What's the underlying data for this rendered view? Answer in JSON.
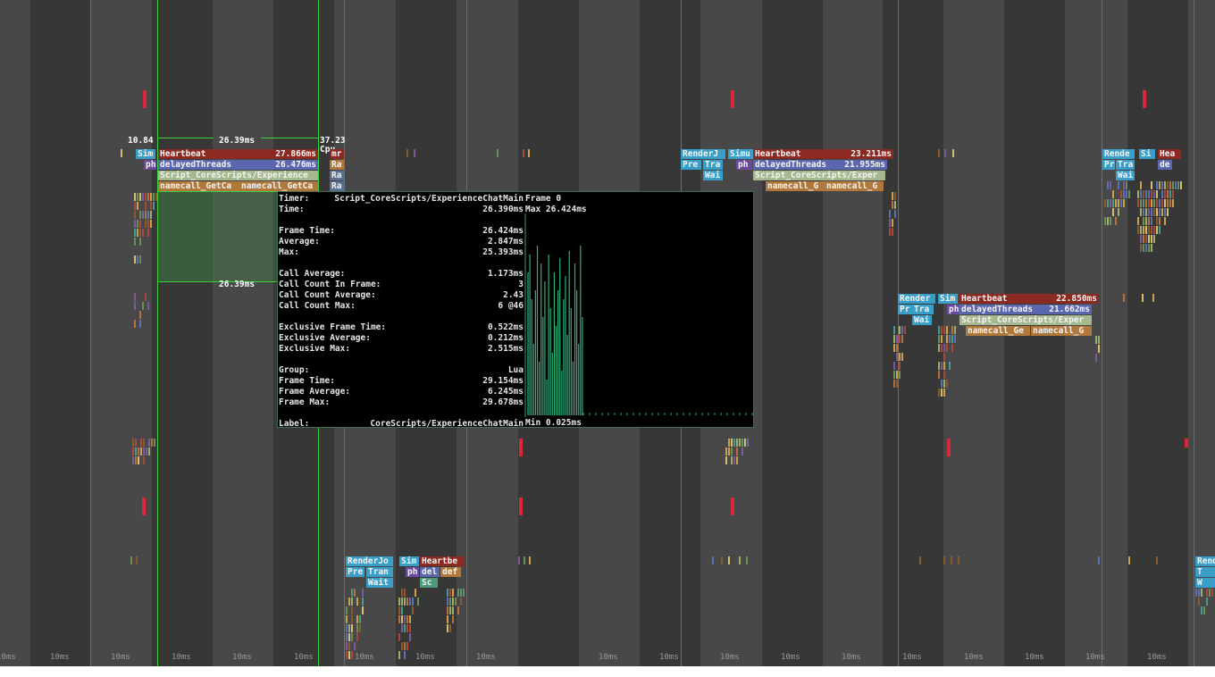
{
  "timeline": {
    "tick_label": "10ms",
    "selection": {
      "top_label": "26.39ms",
      "bottom_label": "26.39ms",
      "left_time": "10.84",
      "right_time": "37.23",
      "right_tag": "Cpu"
    }
  },
  "frames": {
    "frame_a": {
      "sim": "Sim",
      "ph": "ph",
      "heartbeat": {
        "name": "Heartbeat",
        "time": "27.866ms"
      },
      "delayed": {
        "name": "delayedThreads",
        "time": "26.476ms"
      },
      "script": {
        "name": "Script_CoreScripts/Experience"
      },
      "namecall_1": "namecall_GetCa",
      "namecall_2": "namecall_GetCa",
      "side": [
        "mr",
        "Ra",
        "Ra",
        "Ra"
      ]
    },
    "frame_b": {
      "render": "RenderJ",
      "sim": "Simu",
      "pre": "Pre",
      "tra": "Tra",
      "ph": "ph",
      "wait": "Wai",
      "heartbeat": {
        "name": "Heartbeat",
        "time": "23.211ms"
      },
      "delayed": {
        "name": "delayedThreads",
        "time": "21.955ms"
      },
      "script": {
        "name": "Script_CoreScripts/Exper"
      },
      "namecall_1": "namecall_G",
      "namecall_2": "namecall_G"
    },
    "frame_c": {
      "render": "Render",
      "sim": "Sim",
      "pre": "Pr",
      "tra": "Tra",
      "ph": "ph",
      "wait": "Wai",
      "heartbeat": {
        "name": "Heartbeat",
        "time": "22.850ms"
      },
      "delayed": {
        "name": "delayedThreads",
        "time": "21.662ms"
      },
      "script": {
        "name": "Script_CoreScripts/Exper"
      },
      "namecall_1": "namecall_Ge",
      "namecall_2": "namecall_G"
    },
    "frame_d": {
      "render": "Rende",
      "sim": "Si",
      "hea": "Hea",
      "pr": "Pr",
      "tra": "Tra",
      "de": "de",
      "wait": "Wai"
    },
    "frame_e": {
      "render": "RenderJo",
      "sim": "Sim",
      "heartbeat": "Heartbe",
      "pre": "Pre",
      "tran": "Tran",
      "ph": "ph",
      "del": "del",
      "def": "def",
      "wait": "Wait",
      "sc": "Sc"
    },
    "frame_f": {
      "render": "Rend",
      "t": "T",
      "w": "W"
    }
  },
  "tooltip": {
    "timer": {
      "label": "Timer:",
      "value": "Script_CoreScripts/ExperienceChatMain"
    },
    "time": {
      "label": "Time:",
      "value": "26.390ms"
    },
    "frame_time": {
      "label": "Frame Time:",
      "value": "26.424ms"
    },
    "average": {
      "label": "Average:",
      "value": "2.847ms"
    },
    "max": {
      "label": "Max:",
      "value": "25.393ms"
    },
    "call_average": {
      "label": "Call Average:",
      "value": "1.173ms"
    },
    "call_count_in_frame": {
      "label": "Call Count In Frame:",
      "value": "3"
    },
    "call_count_average": {
      "label": "Call Count Average:",
      "value": "2.43"
    },
    "call_count_max": {
      "label": "Call Count Max:",
      "value": "6 @46"
    },
    "exclusive_frame_time": {
      "label": "Exclusive Frame Time:",
      "value": "0.522ms"
    },
    "exclusive_average": {
      "label": "Exclusive Average:",
      "value": "0.212ms"
    },
    "exclusive_max": {
      "label": "Exclusive Max:",
      "value": "2.515ms"
    },
    "group": {
      "label": "Group:",
      "value": "Lua"
    },
    "group_frame_time": {
      "label": "Frame Time:",
      "value": "29.154ms"
    },
    "group_frame_average": {
      "label": "Frame Average:",
      "value": "6.245ms"
    },
    "group_frame_max": {
      "label": "Frame Max:",
      "value": "29.678ms"
    },
    "label_row": {
      "label": "Label:",
      "value": "CoreScripts/ExperienceChatMain"
    },
    "graph": {
      "frame_label": "Frame 0",
      "max_label": "Max 26.424ms",
      "min_label": "Min 0.025ms"
    }
  },
  "colors": {
    "background": "#484848",
    "stripe": "#373737",
    "selection": "#3cd23c",
    "heartbeat": "#8c2a22",
    "delayed": "#5a66ad",
    "script": "#a5b88e",
    "namecall": "#b0783a",
    "render": "#3a9fc8",
    "graph": "#2db07a"
  }
}
